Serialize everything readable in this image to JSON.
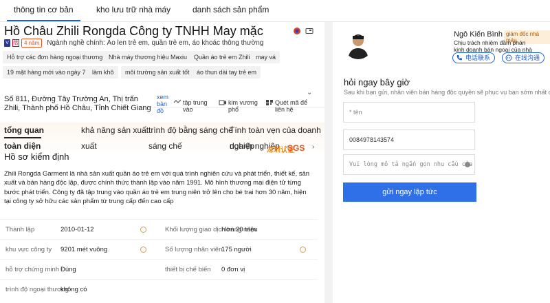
{
  "topnav": {
    "tabs": [
      "thông tin cơ bản",
      "kho lưu trữ nhà máy",
      "danh sách sản phẩm"
    ]
  },
  "company": {
    "title": "Hồ Châu Zhili Rongda Công ty TNHH May mặc",
    "years_badge": "4\nnăm",
    "main_business": "Ngành nghề chính: Áo len trẻ em, quần trẻ em, áo khoác thông thường",
    "chips": [
      "Hỗ trợ các đơn hàng ngoại thương",
      "Nhà máy thương hiệu Maxiu",
      "Quần áo trẻ em Zhili",
      "may vá",
      "19 mặt hàng mới vào ngày 7",
      "làm khô",
      "môi trường sản xuất tốt",
      "áo thun dài tay trẻ em"
    ],
    "address": "Số 811, Đường Tây Trường An, Thị trấn Zhili, Thành phố Hồ Châu, Tỉnh Chiết Giang",
    "map_link": "xem bản đồ",
    "features": [
      "tập trung vào",
      "kim vương phổ",
      "Quét mã để liên hệ"
    ]
  },
  "section_tabs": {
    "items": [
      "tổng quan",
      "khả năng sản xuất",
      "trình độ bằng sáng chế",
      "Tính toàn vẹn của doanh nghiệp"
    ],
    "overview_line2": "toàn diện",
    "line2": [
      "xuất",
      "sáng chế",
      "doanh nghiệp"
    ],
    "certs": [
      "深圳认证",
      "SGS"
    ]
  },
  "profile": {
    "title": "Hồ sơ kiểm định",
    "description": "Zhili Rongda Garment là nhà sản xuất quần áo trẻ em với quá trình nghiên cứu và phát triển, thiết kế, sản xuất và bán hàng độc lập, được chính thức thành lập vào năm 1991. Mô hình thương mại điện tử từng bước phát triển. Công ty đã tập trung vào quần áo trẻ em trung niên trở lên cho bé trai hơn 30 năm, hiện tại công ty sở hữu các sản phẩm từ trung cấp đến cao cấp",
    "rows": [
      {
        "l1": "Thành lập",
        "v1": "2010-01-12",
        "l2": "Khối lượng giao dịch hàng năm",
        "v2": "Hơn 20 triệu"
      },
      {
        "l1": "khu vực công ty",
        "v1": "9201 mét vuông",
        "l2": "Số lượng nhân viên",
        "v2": "175 người"
      },
      {
        "l1": "hỗ trợ chứng minh",
        "v1": "Đúng",
        "l2": "thiết bị chế biến",
        "v2": "0 đơn vị"
      },
      {
        "l1": "trình độ ngoại thương",
        "v1": "không có",
        "l2": "",
        "v2": ""
      }
    ]
  },
  "rep": {
    "name": "Ngô Kiến Bình",
    "role": "giám đốc nhà máy",
    "desc": "Chịu trách nhiệm đầm phán kinh doanh bán ngoại của nhà máy",
    "btn_call": "电话联系",
    "btn_chat": "在线沟通"
  },
  "inquiry": {
    "title": "hỏi ngay bây giờ",
    "subtitle": "Sau khi bạn gửi, nhân viên bán hàng độc quyền sẽ phục vụ bạn sớm nhất có thể",
    "name_placeholder": "* tên",
    "phone_value": "0084978143574",
    "message_placeholder": "Vui lòng mô tả ngắn gọn nhu cầu của bạn",
    "submit_label": "gửi ngay lập tức"
  },
  "colors": {
    "accent": "#2f6fe8",
    "link": "#1a5fd6",
    "role_bg": "#fdeed9"
  }
}
